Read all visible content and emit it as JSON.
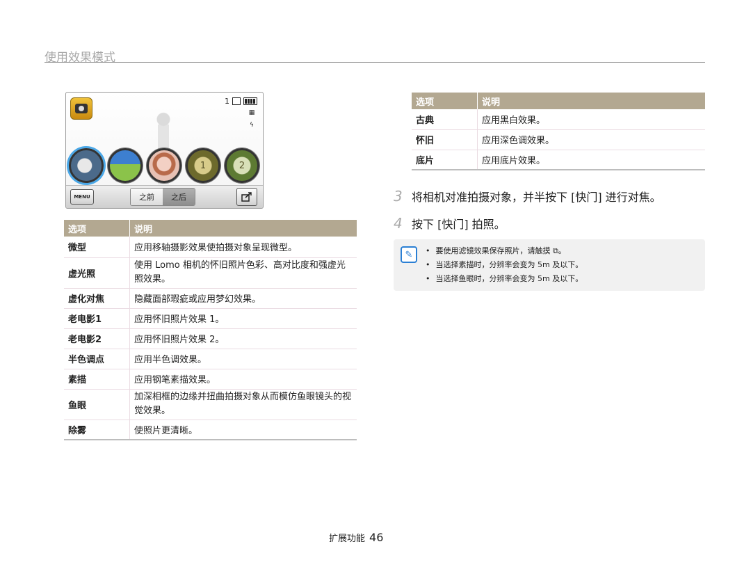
{
  "page_title": "使用效果模式",
  "camera_screen": {
    "shot_count": "1",
    "mode_icon": "camera-mode-icon",
    "thumb_4_label": "1",
    "thumb_5_label": "2",
    "menu_label": "MENU",
    "before_label": "之前",
    "after_label": "之后"
  },
  "left_table": {
    "headers": [
      "选项",
      "说明"
    ],
    "rows": [
      {
        "option": "微型",
        "desc": "应用移轴摄影效果使拍摄对象呈现微型。"
      },
      {
        "option": "虚光照",
        "desc": "使用 Lomo 相机的怀旧照片色彩、高对比度和强虚光照效果。"
      },
      {
        "option": "虚化对焦",
        "desc": "隐藏面部瑕疵或应用梦幻效果。"
      },
      {
        "option": "老电影1",
        "desc": "应用怀旧照片效果 1。"
      },
      {
        "option": "老电影2",
        "desc": "应用怀旧照片效果 2。"
      },
      {
        "option": "半色调点",
        "desc": "应用半色调效果。"
      },
      {
        "option": "素描",
        "desc": "应用钢笔素描效果。"
      },
      {
        "option": "鱼眼",
        "desc": "加深相框的边缘并扭曲拍摄对象从而模仿鱼眼镜头的视觉效果。"
      },
      {
        "option": "除雾",
        "desc": "使照片更清晰。"
      }
    ]
  },
  "right_table": {
    "headers": [
      "选项",
      "说明"
    ],
    "rows": [
      {
        "option": "古典",
        "desc": "应用黑白效果。"
      },
      {
        "option": "怀旧",
        "desc": "应用深色调效果。"
      },
      {
        "option": "底片",
        "desc": "应用底片效果。"
      }
    ]
  },
  "steps": [
    {
      "num": "3",
      "text": "将相机对准拍摄对象，并半按下 [快门] 进行对焦。"
    },
    {
      "num": "4",
      "text": "按下 [快门] 拍照。"
    }
  ],
  "notes": [
    "要使用滤镜效果保存照片，请触摸 ⧉。",
    "当选择素描时，分辨率会变为 5m 及以下。",
    "当选择鱼眼时，分辨率会变为 5m 及以下。"
  ],
  "footer": {
    "section": "扩展功能",
    "page": "46"
  }
}
